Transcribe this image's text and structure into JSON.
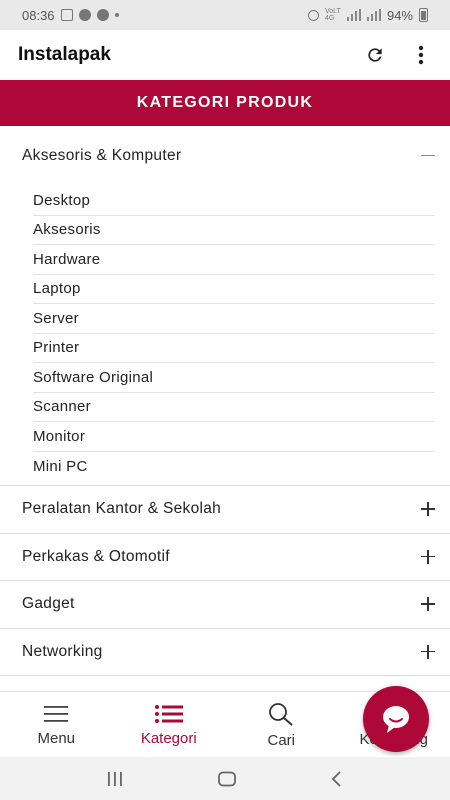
{
  "status_bar": {
    "time": "08:36",
    "battery": "94%",
    "network": "VoLTE 4G"
  },
  "app": {
    "title": "Instalapak"
  },
  "banner": {
    "title": "KATEGORI PRODUK"
  },
  "expanded_category": {
    "label": "Aksesoris & Komputer",
    "subitems": [
      "Desktop",
      "Aksesoris",
      "Hardware",
      "Laptop",
      "Server",
      "Printer",
      "Software Original",
      "Scanner",
      "Monitor",
      "Mini PC"
    ]
  },
  "categories": [
    "Peralatan Kantor & Sekolah",
    "Perkakas & Otomotif",
    "Gadget",
    "Networking"
  ],
  "bottom_nav": [
    {
      "label": "Menu",
      "icon": "menu-icon"
    },
    {
      "label": "Kategori",
      "icon": "list-icon",
      "active": true
    },
    {
      "label": "Cari",
      "icon": "search-icon"
    },
    {
      "label": "Keranjang",
      "icon": "cart-icon"
    }
  ],
  "colors": {
    "accent": "#ad0838"
  }
}
